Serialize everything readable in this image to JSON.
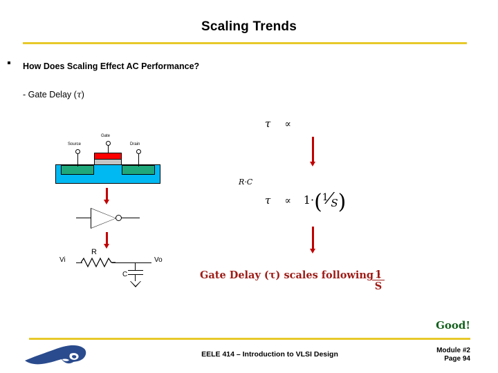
{
  "slide": {
    "title": "Scaling Trends",
    "rule_color": "#E7C829"
  },
  "bullets": {
    "bullet_marker": "▪",
    "bullet_1": "How Does Scaling Effect AC Performance?",
    "subbullet_1_prefix": "- Gate Delay  (",
    "subbullet_1_symbol": "τ",
    "subbullet_1_suffix": ")"
  },
  "transistor": {
    "source_label": "Source",
    "gate_label": "Gate",
    "drain_label": "Drain",
    "substrate_color": "#00B9F2",
    "diffusion_color": "#1FA87A",
    "oxide_color": "#C4C4C4",
    "gate_color": "#FF0000"
  },
  "rc_circuit": {
    "input_label": "Vi",
    "output_label": "Vo",
    "resistor_label": "R",
    "capacitor_label": "C"
  },
  "equations": {
    "eq1_symbol": "τ",
    "eq1_relation": "∝",
    "rc_label": "R·C",
    "eq2_symbol": "τ",
    "eq2_relation": "∝",
    "eq2_rhs_lead": "1·",
    "eq2_numerator": "1",
    "eq2_denominator": "S"
  },
  "conclusion": {
    "text": "Gate Delay (τ) scales following :",
    "fraction_numerator": "1",
    "fraction_denominator": "S",
    "verdict": "Good!",
    "verdict_color": "#14601E",
    "text_color": "#9E1B16"
  },
  "footer": {
    "course": "EELE 414 – Introduction to VLSI Design",
    "module": "Module #2",
    "page": "Page 94",
    "logo_color": "#2A4B8D"
  },
  "arrows": {
    "color": "#C00000"
  }
}
